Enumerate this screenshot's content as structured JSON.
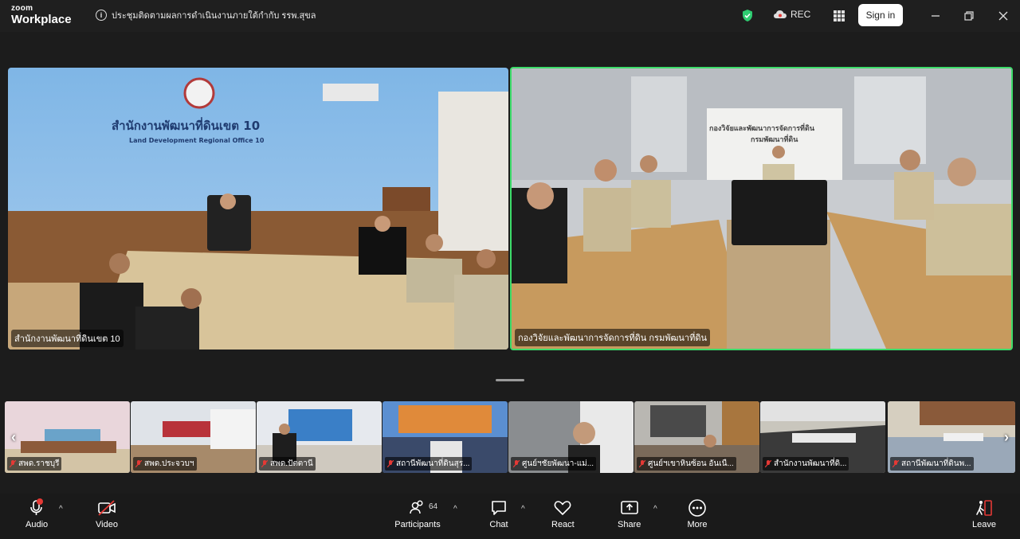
{
  "app": {
    "brand_small": "zoom",
    "brand_big": "Workplace"
  },
  "meeting": {
    "topic": "ประชุมติดตามผลการดำเนินงานภายใต้กำกับ รรพ.สุขล"
  },
  "topbar": {
    "rec_label": "REC",
    "signin_label": "Sign in"
  },
  "main_tiles": [
    {
      "name": "สำนักงานพัฒนาที่ดินเขต 10",
      "sign_text": "สำนักงานพัฒนาที่ดินเขต 10",
      "sign_sub": "Land Development Regional Office 10"
    },
    {
      "name": "กองวิจัยและพัฒนาการจัดการที่ดิน กรมพัฒนาที่ดิน",
      "sign_text": "กองวิจัยและพัฒนาการจัดการที่ดิน",
      "sign_sub": "กรมพัฒนาที่ดิน"
    }
  ],
  "thumbnails": [
    {
      "name": "สพด.ราชบุรี"
    },
    {
      "name": "สพด.ประจวบฯ"
    },
    {
      "name": "สพด.ปัตตานี"
    },
    {
      "name": "สถานีพัฒนาที่ดินสุร..."
    },
    {
      "name": "ศูนย์ฯชัยพัฒนา-แม่..."
    },
    {
      "name": "ศูนย์ฯเขาหินซ้อน อันเนื..."
    },
    {
      "name": "สำนักงานพัฒนาที่ดิ..."
    },
    {
      "name": "สถานีพัฒนาที่ดินพ..."
    }
  ],
  "toolbar": {
    "audio": "Audio",
    "video": "Video",
    "participants": "Participants",
    "participants_count": "64",
    "chat": "Chat",
    "react": "React",
    "share": "Share",
    "more": "More",
    "leave": "Leave"
  },
  "colors": {
    "active_speaker": "#3ddc6a",
    "muted": "#e53935",
    "shield": "#2ecc71"
  }
}
